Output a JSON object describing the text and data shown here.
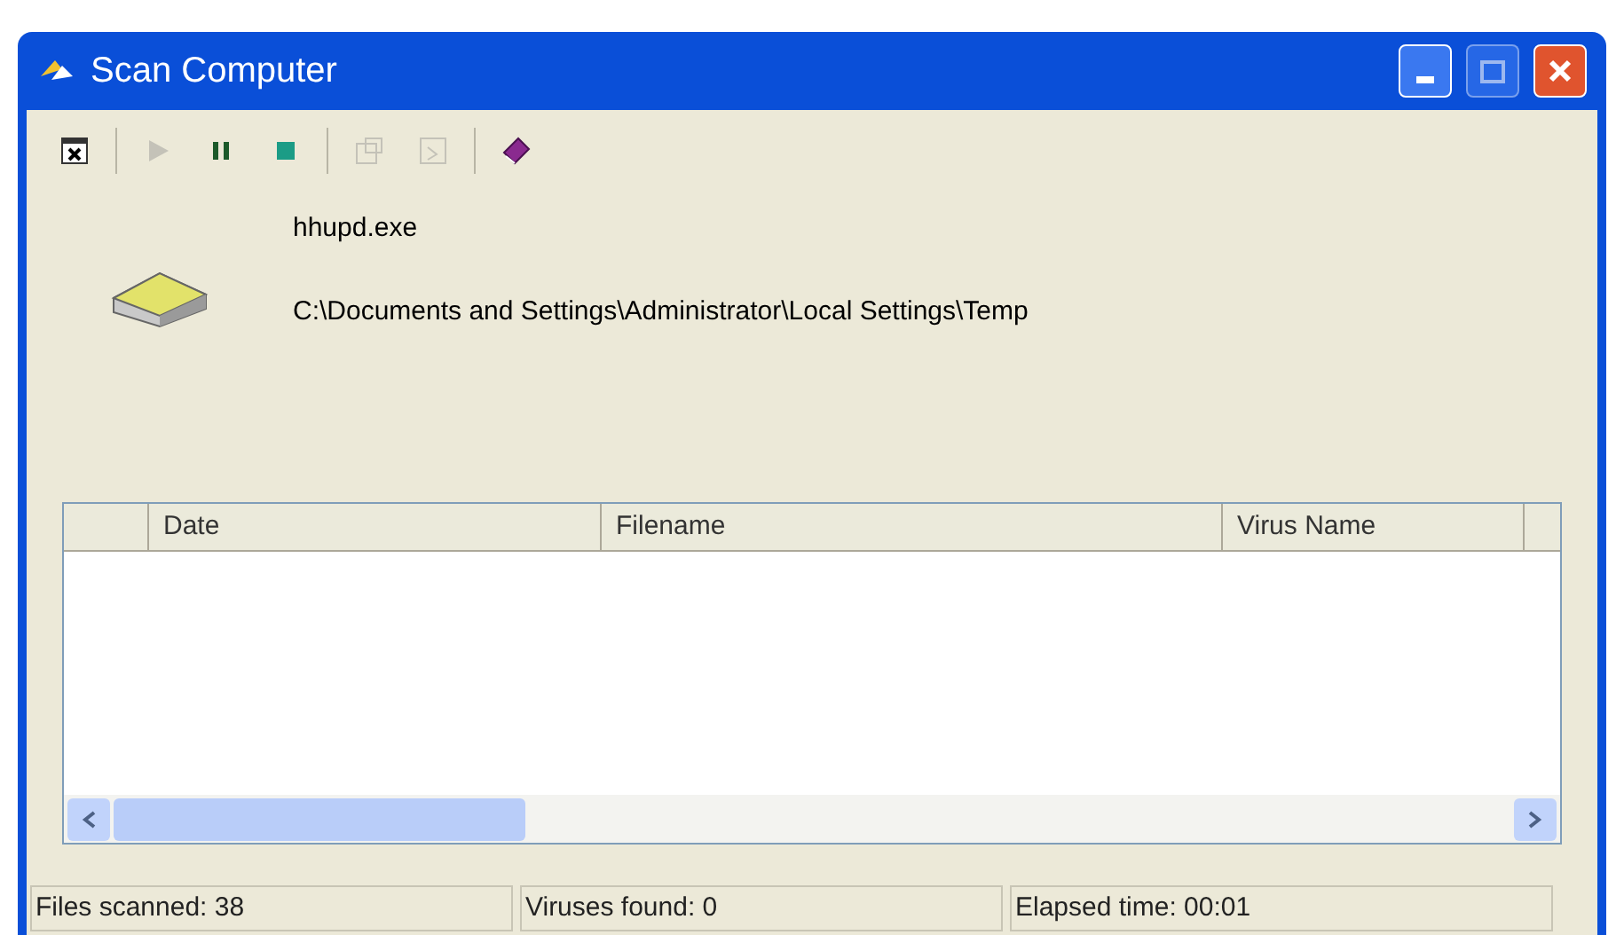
{
  "window": {
    "title": "Scan Computer"
  },
  "toolbar": [
    {
      "kind": "close",
      "disabled": false
    },
    {
      "kind": "separator"
    },
    {
      "kind": "play",
      "disabled": true
    },
    {
      "kind": "pause",
      "disabled": false
    },
    {
      "kind": "stop",
      "disabled": false
    },
    {
      "kind": "separator"
    },
    {
      "kind": "properties",
      "disabled": true
    },
    {
      "kind": "export",
      "disabled": true
    },
    {
      "kind": "separator"
    },
    {
      "kind": "book",
      "disabled": false
    }
  ],
  "current_file": {
    "name": "hhupd.exe",
    "path": "C:\\Documents and Settings\\Administrator\\Local Settings\\Temp"
  },
  "table": {
    "columns": [
      "Date",
      "Filename",
      "Virus Name"
    ]
  },
  "status_bar": [
    "Files scanned: 38",
    "Viruses found: 0",
    "Elapsed time: 00:01"
  ]
}
